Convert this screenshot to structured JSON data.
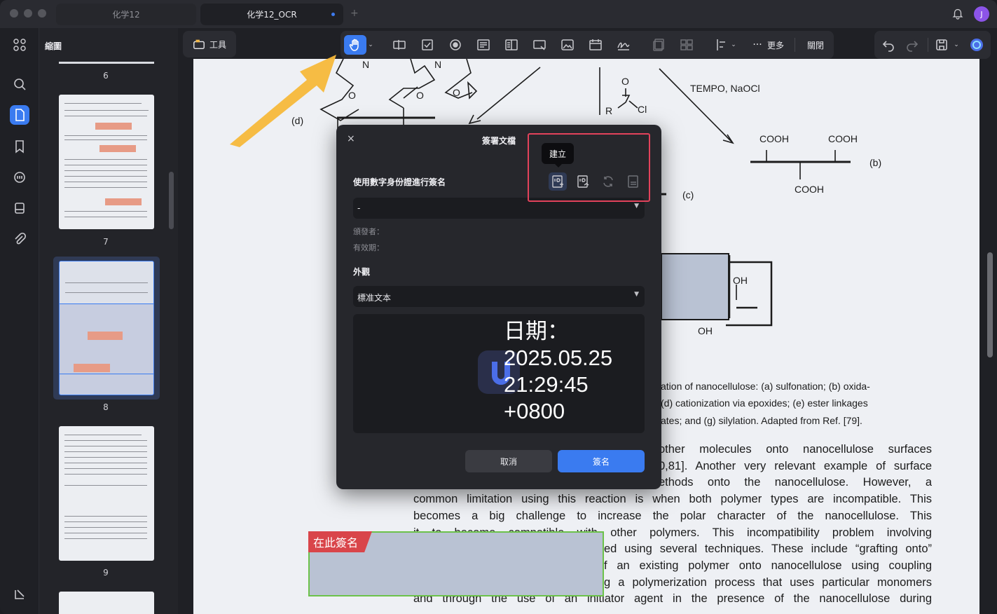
{
  "tabs": [
    {
      "label": "化学12"
    },
    {
      "label": "化学12_OCR"
    }
  ],
  "user": {
    "initial": "J"
  },
  "thumbnail_panel": {
    "title": "縮圖",
    "pages": [
      {
        "number": "6"
      },
      {
        "number": "7"
      },
      {
        "number": "8"
      },
      {
        "number": "9"
      }
    ]
  },
  "toolbar": {
    "tools_label": "工具",
    "more_label": "更多",
    "close_label": "關閉"
  },
  "document": {
    "chem_labels": {
      "tempo": "TEMPO, NaOCl",
      "cooh": "COOH",
      "b": "(b)",
      "c": "(c)",
      "d": "(d)",
      "oh": "OH",
      "r": "R",
      "o": "O",
      "cl": "Cl",
      "n": "N"
    },
    "caption_lines": [
      "ation of nanocellulose: (a) sulfonation; (b) oxida-",
      "(d) cationization via epoxides; (e) ester linkages",
      "ates; and (g) silylation. Adapted from Ref. [79]."
    ],
    "body_lines": [
      "other molecules onto nanocellulose surfaces",
      "0,81]. Another very relevant example of surface",
      "ethods onto the nanocellulose. However, a",
      "common limitation using this reaction is when both polymer types are incompatible. This",
      "becomes a big challenge to increase the polar character of the nanocellulose. This",
      "it to become compatible with other polymers. This incompatibility problem involving",
      "ed using several techniques. These include “grafting onto”",
      "f an existing polymer onto nanocellulose using coupling",
      "g a polymerization process that uses particular monomers",
      "and through the use of an initiator agent in the presence of the nanocellulose during"
    ],
    "sign_here_label": "在此簽名"
  },
  "dialog": {
    "title": "簽署文檔",
    "digital_id_label": "使用數字身份證進行簽名",
    "digital_id_value": "-",
    "issuer_label": "頒發者：",
    "validity_label": "有效期：",
    "appearance_label": "外觀",
    "appearance_value": "標准文本",
    "preview_lines": [
      "日期：",
      "2025.05.25",
      "21:29:45",
      "+0800"
    ],
    "cancel_label": "取消",
    "sign_label": "簽名",
    "tooltip_create": "建立"
  },
  "colors": {
    "accent": "#3a7bf0",
    "highlight_box": "#e2425b",
    "arrow": "#f5b83a",
    "sign_tag": "#d9454a",
    "sign_border": "#6cc24a"
  }
}
